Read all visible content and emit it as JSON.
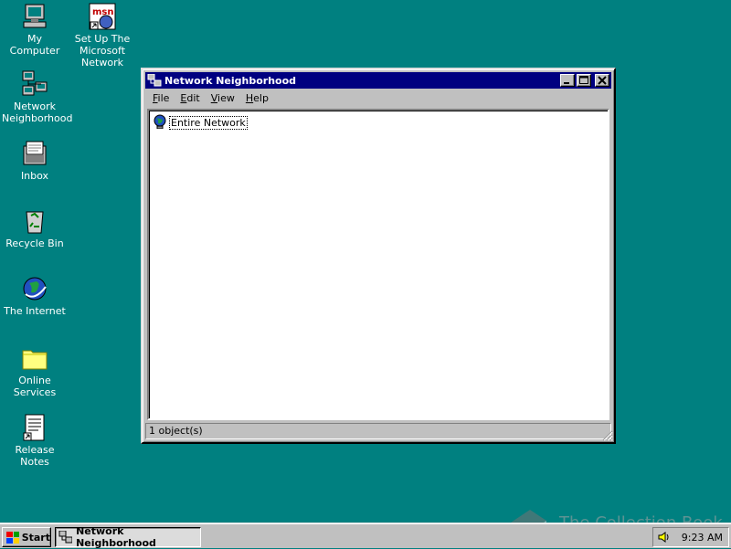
{
  "colors": {
    "desktop": "#008080",
    "titlebar": "#000080",
    "face": "#c0c0c0"
  },
  "desktop": {
    "icons": [
      {
        "label": "My Computer",
        "icon": "my-computer-icon"
      },
      {
        "label": "Set Up The\nMicrosoft\nNetwork",
        "icon": "msn-setup-icon"
      },
      {
        "label": "Network\nNeighborhood",
        "icon": "network-neighborhood-icon"
      },
      {
        "label": "Inbox",
        "icon": "inbox-icon"
      },
      {
        "label": "Recycle Bin",
        "icon": "recycle-bin-icon"
      },
      {
        "label": "The Internet",
        "icon": "internet-icon"
      },
      {
        "label": "Online\nServices",
        "icon": "folder-icon"
      },
      {
        "label": "Release Notes",
        "icon": "document-shortcut-icon"
      }
    ]
  },
  "window": {
    "title": "Network Neighborhood",
    "controls": {
      "minimize": "_",
      "maximize": "□",
      "close": "×"
    },
    "menu": [
      {
        "label": "File",
        "accel": "F",
        "rest": "ile"
      },
      {
        "label": "Edit",
        "accel": "E",
        "rest": "dit"
      },
      {
        "label": "View",
        "accel": "V",
        "rest": "iew"
      },
      {
        "label": "Help",
        "accel": "H",
        "rest": "elp"
      }
    ],
    "items": [
      {
        "label": "Entire Network",
        "icon": "globe-network-icon"
      }
    ],
    "status": "1 object(s)"
  },
  "taskbar": {
    "start_label": "Start",
    "task_label": "Network Neighborhood",
    "clock": "9:23 AM"
  },
  "watermark": {
    "text": "The Collection Book"
  }
}
